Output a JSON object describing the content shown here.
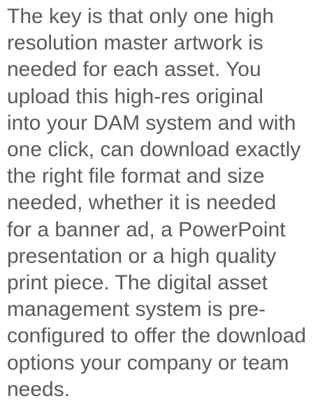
{
  "article": {
    "lines": [
      "The key is that only one high",
      "resolution master artwork is",
      "needed for each asset. You",
      "upload this high-res original",
      "into your DAM system and with",
      "one click, can download exactly",
      "the right file format and size",
      "needed, whether it is needed",
      "for a banner ad, a PowerPoint",
      "presentation or a high quality",
      "print piece. The digital asset",
      "management system is pre-",
      "configured to offer the download",
      "options your company or team",
      "needs."
    ]
  }
}
